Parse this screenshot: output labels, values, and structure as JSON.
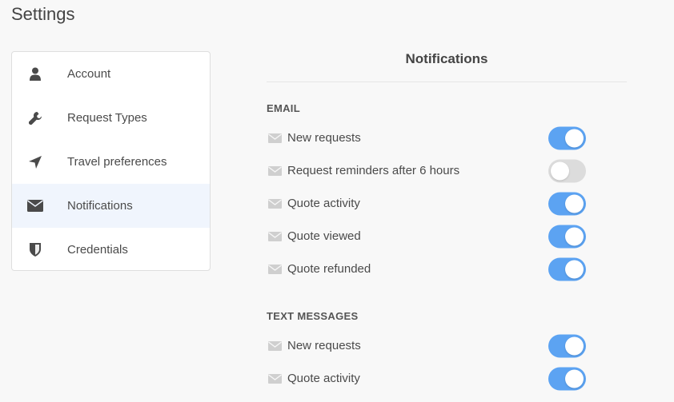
{
  "page": {
    "title": "Settings"
  },
  "sidebar": {
    "items": [
      {
        "label": "Account",
        "icon": "user-icon",
        "active": false
      },
      {
        "label": "Request Types",
        "icon": "wrench-icon",
        "active": false
      },
      {
        "label": "Travel preferences",
        "icon": "location-arrow-icon",
        "active": false
      },
      {
        "label": "Notifications",
        "icon": "envelope-icon",
        "active": true
      },
      {
        "label": "Credentials",
        "icon": "shield-icon",
        "active": false
      }
    ]
  },
  "main": {
    "title": "Notifications",
    "email": {
      "heading": "EMAIL",
      "rows": [
        {
          "label": "New requests",
          "enabled": true
        },
        {
          "label": "Request reminders after 6 hours",
          "enabled": false
        },
        {
          "label": "Quote activity",
          "enabled": true
        },
        {
          "label": "Quote viewed",
          "enabled": true
        },
        {
          "label": "Quote refunded",
          "enabled": true
        }
      ]
    },
    "text_messages": {
      "heading": "TEXT MESSAGES",
      "rows": [
        {
          "label": "New requests",
          "enabled": true
        },
        {
          "label": "Quote activity",
          "enabled": true
        }
      ]
    }
  },
  "colors": {
    "toggle_on": "#5ca3f2",
    "toggle_off": "#dcdcdc",
    "active_item_bg": "#f0f5fd"
  }
}
